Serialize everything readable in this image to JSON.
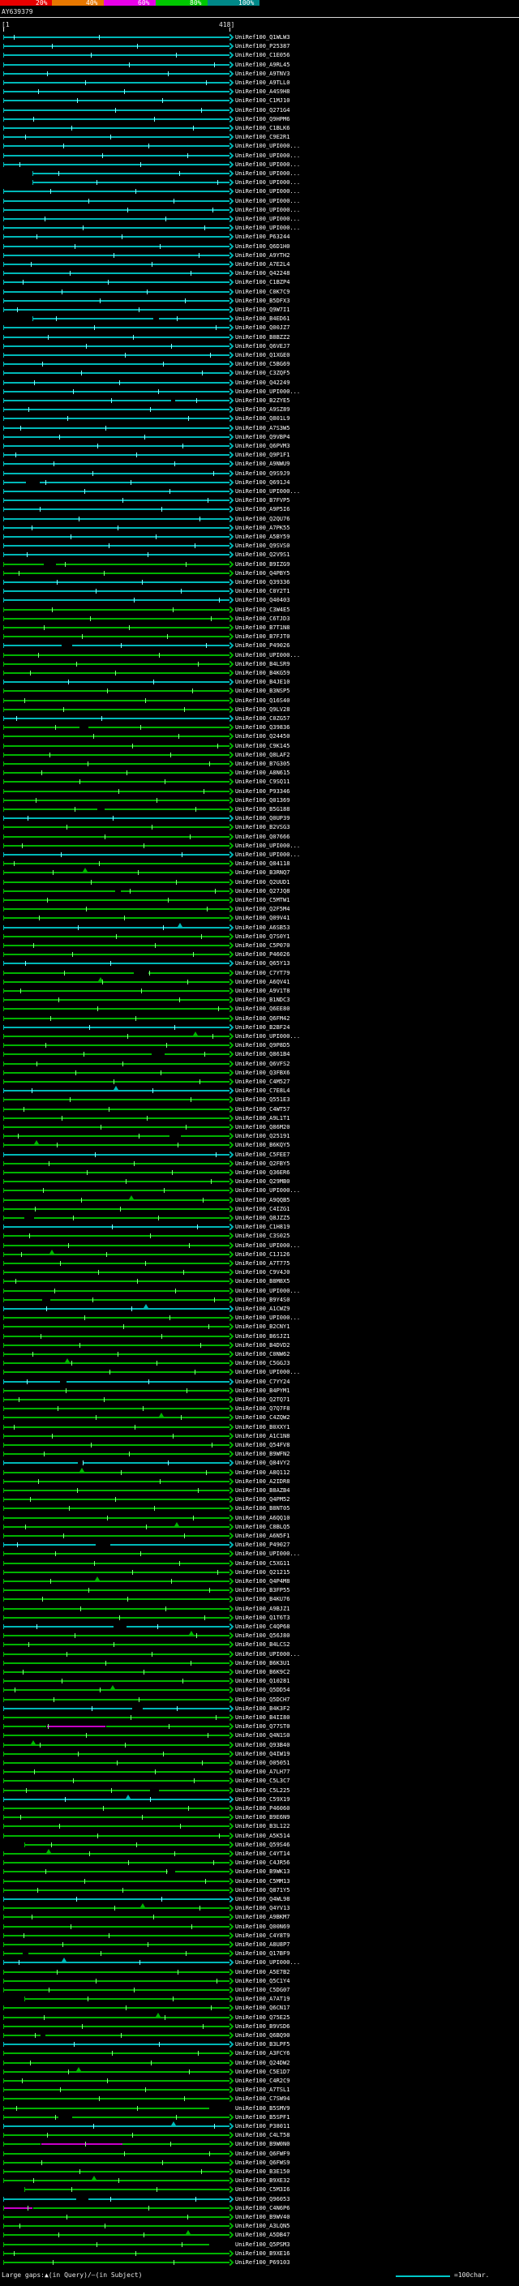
{
  "key": {
    "labels": [
      "20%",
      "40%",
      "60%",
      "80%",
      "100%"
    ],
    "colors": [
      "#e80000",
      "#e87800",
      "#e800e8",
      "#00c800",
      "#008888"
    ]
  },
  "ruler": {
    "left": "[1",
    "right": "418]"
  },
  "footer": {
    "legend_gaps": "Large gaps:▲(in Query)/—(in Subject)",
    "legend_scale": "=100char.",
    "scale_swatch_color": "#00c8c8"
  },
  "chart_data": {
    "type": "bar",
    "orientation": "horizontal",
    "title": "BLAST hit distribution vs UniRef100",
    "query": "AY639379",
    "x_range": [
      1,
      418
    ],
    "legend_position": "top",
    "grid": false,
    "id_prefix": "UniRef100_",
    "colors": {
      "c": "#00b8b8",
      "g": "#00b400",
      "m": "#c800c8"
    },
    "tick_colors": {
      "c": "#80ffff",
      "g": "#80ff80",
      "m": "#ff80ff"
    },
    "color_meaning": {
      "c": "80-100% identity",
      "g": "60-80% identity",
      "m": "40-60% identity"
    },
    "rows": [
      [
        "Q1WLW3",
        "c"
      ],
      [
        "P25387",
        "c"
      ],
      [
        "C1E056",
        "c"
      ],
      [
        "A9RL45",
        "c"
      ],
      [
        "A9TNV3",
        "c"
      ],
      [
        "A9TLL0",
        "c"
      ],
      [
        "A4S9H8",
        "c"
      ],
      [
        "C1MJ10",
        "c"
      ],
      [
        "Q271G4",
        "c"
      ],
      [
        "Q9HPM6",
        "c"
      ],
      [
        "C1BLK6",
        "c"
      ],
      [
        "C9E2R1",
        "c"
      ],
      [
        "UPI000...",
        "c"
      ],
      [
        "UPI000...",
        "c"
      ],
      [
        "UPI000...",
        "c"
      ],
      [
        "UPI000...",
        "c",
        {
          "s": 55
        }
      ],
      [
        "UPI000...",
        "c",
        {
          "s": 55
        }
      ],
      [
        "UPI000...",
        "c"
      ],
      [
        "UPI000...",
        "c"
      ],
      [
        "UPI000...",
        "c"
      ],
      [
        "UPI000...",
        "c"
      ],
      [
        "UPI000...",
        "c"
      ],
      [
        "P63244",
        "c"
      ],
      [
        "Q6D1H0",
        "c"
      ],
      [
        "A9YTH2",
        "c"
      ],
      [
        "A7E2L4",
        "c"
      ],
      [
        "Q42248",
        "c"
      ],
      [
        "C1BZP4",
        "c"
      ],
      [
        "C0K7C9",
        "c"
      ],
      [
        "B5DFX3",
        "c"
      ],
      [
        "Q9W7I1",
        "c"
      ],
      [
        "B4ED61",
        "c",
        {
          "s": 55
        }
      ],
      [
        "Q00JZ7",
        "c"
      ],
      [
        "B8BZZ2",
        "c"
      ],
      [
        "Q6VEJ7",
        "c"
      ],
      [
        "Q1XGE0",
        "c"
      ],
      [
        "C5BG69",
        "c"
      ],
      [
        "C3ZQF5",
        "c"
      ],
      [
        "Q42249",
        "c"
      ],
      [
        "UPI000...",
        "c"
      ],
      [
        "B2ZYE5",
        "c"
      ],
      [
        "A9SZ89",
        "c"
      ],
      [
        "Q801L9",
        "c"
      ],
      [
        "A7S3W5",
        "c"
      ],
      [
        "Q9VBP4",
        "c"
      ],
      [
        "Q6PVM3",
        "c"
      ],
      [
        "Q9P1F1",
        "c"
      ],
      [
        "A9NWU9",
        "c"
      ],
      [
        "Q9S9J9",
        "c"
      ],
      [
        "Q691J4",
        "c"
      ],
      [
        "UPI000...",
        "c"
      ],
      [
        "B7FVP5",
        "c"
      ],
      [
        "A9P5I6",
        "c"
      ],
      [
        "Q2QU76",
        "c"
      ],
      [
        "A7PK55",
        "c"
      ],
      [
        "A5BY59",
        "c"
      ],
      [
        "Q9SVS0",
        "c"
      ],
      [
        "Q2V9S1",
        "c"
      ],
      [
        "B9IZG9",
        "g"
      ],
      [
        "Q4PBY5",
        "g"
      ],
      [
        "Q39336",
        "c"
      ],
      [
        "C0Y2T1",
        "c"
      ],
      [
        "Q40403",
        "c"
      ],
      [
        "C3W4E5",
        "g"
      ],
      [
        "C6TJD3",
        "g"
      ],
      [
        "B7T1N8",
        "g"
      ],
      [
        "B7FJT0",
        "g"
      ],
      [
        "P49026",
        "c"
      ],
      [
        "UPI000...",
        "g"
      ],
      [
        "B4LSR9",
        "g"
      ],
      [
        "B4KG59",
        "g"
      ],
      [
        "B4JE10",
        "c"
      ],
      [
        "B3NSP5",
        "g"
      ],
      [
        "Q16S40",
        "g"
      ],
      [
        "Q9LV28",
        "g"
      ],
      [
        "C0ZG57",
        "c"
      ],
      [
        "Q39836",
        "g"
      ],
      [
        "Q24450",
        "g"
      ],
      [
        "C9K145",
        "g"
      ],
      [
        "Q8LAF2",
        "g"
      ],
      [
        "B7G305",
        "g"
      ],
      [
        "A8N615",
        "g"
      ],
      [
        "C9SQ11",
        "g"
      ],
      [
        "P93346",
        "g"
      ],
      [
        "Q01369",
        "g"
      ],
      [
        "B5G188",
        "g"
      ],
      [
        "Q0UP39",
        "c"
      ],
      [
        "B2VSG3",
        "g"
      ],
      [
        "Q07666",
        "g"
      ],
      [
        "UPI000...",
        "g"
      ],
      [
        "UPI000...",
        "c"
      ],
      [
        "Q84118",
        "g"
      ],
      [
        "B3RNQ7",
        "g"
      ],
      [
        "Q2UUD1",
        "g"
      ],
      [
        "Q27JQ8",
        "g"
      ],
      [
        "C5MTW1",
        "g"
      ],
      [
        "Q2F5M4",
        "g"
      ],
      [
        "Q09V41",
        "g"
      ],
      [
        "A6SB53",
        "c"
      ],
      [
        "Q7S0Y1",
        "g"
      ],
      [
        "C5P070",
        "g"
      ],
      [
        "P46026",
        "g"
      ],
      [
        "Q65Y13",
        "c"
      ],
      [
        "C7YT79",
        "g"
      ],
      [
        "A6QV41",
        "g"
      ],
      [
        "A9V1T8",
        "g"
      ],
      [
        "B1NDC3",
        "g"
      ],
      [
        "Q6EE80",
        "g"
      ],
      [
        "Q6FM42",
        "g"
      ],
      [
        "B2BF24",
        "c"
      ],
      [
        "UPI000...",
        "g"
      ],
      [
        "Q9P8D5",
        "g"
      ],
      [
        "Q861B4",
        "g"
      ],
      [
        "Q6VFS2",
        "g"
      ],
      [
        "Q3FBX6",
        "g"
      ],
      [
        "C4M527",
        "g"
      ],
      [
        "C7E8L4",
        "c"
      ],
      [
        "Q551E3",
        "g"
      ],
      [
        "C4WT57",
        "g"
      ],
      [
        "A9L1T1",
        "g"
      ],
      [
        "Q86M20",
        "g"
      ],
      [
        "Q25191",
        "g"
      ],
      [
        "B6KQY5",
        "g"
      ],
      [
        "C5FEE7",
        "c"
      ],
      [
        "Q2FBY5",
        "g"
      ],
      [
        "Q36ER6",
        "g"
      ],
      [
        "Q29MB0",
        "g"
      ],
      [
        "UPI000...",
        "g"
      ],
      [
        "A9QQB5",
        "g"
      ],
      [
        "C4IZG1",
        "g"
      ],
      [
        "Q8JZZ5",
        "g"
      ],
      [
        "C1H819",
        "c"
      ],
      [
        "C3S025",
        "g"
      ],
      [
        "UPI000...",
        "g"
      ],
      [
        "C1J126",
        "g"
      ],
      [
        "A7T775",
        "g"
      ],
      [
        "C9V4J0",
        "g"
      ],
      [
        "B8M8X5",
        "g"
      ],
      [
        "UPI000...",
        "g"
      ],
      [
        "B9Y4S0",
        "g"
      ],
      [
        "A1CWZ9",
        "c"
      ],
      [
        "UPI000...",
        "g"
      ],
      [
        "B2CNY1",
        "g"
      ],
      [
        "B6SJZ1",
        "g"
      ],
      [
        "B4DVD2",
        "g"
      ],
      [
        "C0NW62",
        "g"
      ],
      [
        "C5GGJ3",
        "g"
      ],
      [
        "UPI000...",
        "g"
      ],
      [
        "C7YY24",
        "c"
      ],
      [
        "B4PYM1",
        "g"
      ],
      [
        "Q2TQ71",
        "g"
      ],
      [
        "Q7Q7F8",
        "g"
      ],
      [
        "C4ZQW2",
        "g"
      ],
      [
        "B0XXY1",
        "g"
      ],
      [
        "A1C1N8",
        "g"
      ],
      [
        "Q54FV8",
        "g"
      ],
      [
        "B9WFN2",
        "g"
      ],
      [
        "Q84VY2",
        "c"
      ],
      [
        "A8Q112",
        "g"
      ],
      [
        "A2IDR8",
        "g"
      ],
      [
        "B8AZB4",
        "g"
      ],
      [
        "Q4PM52",
        "g"
      ],
      [
        "B8NT05",
        "g"
      ],
      [
        "A6QQ10",
        "g"
      ],
      [
        "C8BLQ5",
        "g"
      ],
      [
        "A6N5F1",
        "g"
      ],
      [
        "P49027",
        "c"
      ],
      [
        "UPI000...",
        "g"
      ],
      [
        "C5XG11",
        "g"
      ],
      [
        "Q21215",
        "g"
      ],
      [
        "Q4P4M8",
        "g"
      ],
      [
        "B3FP55",
        "g"
      ],
      [
        "B4KU76",
        "g"
      ],
      [
        "A9BJZ1",
        "g"
      ],
      [
        "Q1T6T3",
        "g"
      ],
      [
        "C4QP68",
        "c"
      ],
      [
        "Q56J80",
        "g"
      ],
      [
        "B4LCS2",
        "g"
      ],
      [
        "UPI000...",
        "g"
      ],
      [
        "B6K3U1",
        "g"
      ],
      [
        "B6K9C2",
        "g"
      ],
      [
        "Q10281",
        "g"
      ],
      [
        "Q5DD54",
        "g"
      ],
      [
        "Q5DCH7",
        "g"
      ],
      [
        "B4K3F2",
        "c"
      ],
      [
        "B4II80",
        "g"
      ],
      [
        "Q77ST0",
        "g",
        {
          "segs": [
            [
              1,
              80,
              "g"
            ],
            [
              81,
              190,
              "m"
            ],
            [
              191,
              418,
              "g"
            ]
          ]
        }
      ],
      [
        "Q4N1S0",
        "g"
      ],
      [
        "Q93B40",
        "g"
      ],
      [
        "Q4IW19",
        "g"
      ],
      [
        "O05051",
        "g"
      ],
      [
        "A7LH77",
        "g"
      ],
      [
        "C5L3C7",
        "g"
      ],
      [
        "C5L225",
        "g"
      ],
      [
        "C59X19",
        "c"
      ],
      [
        "P46060",
        "g"
      ],
      [
        "B9E6N9",
        "g"
      ],
      [
        "B3L122",
        "g"
      ],
      [
        "A5K514",
        "g"
      ],
      [
        "Q59S46",
        "g",
        {
          "s": 40
        }
      ],
      [
        "C4YT14",
        "g"
      ],
      [
        "C4JR56",
        "g"
      ],
      [
        "B9WK13",
        "g"
      ],
      [
        "C5MM13",
        "g"
      ],
      [
        "Q871Y5",
        "g"
      ],
      [
        "Q4WL98",
        "c"
      ],
      [
        "Q4YV13",
        "g"
      ],
      [
        "A9BKM7",
        "g"
      ],
      [
        "Q00N69",
        "g"
      ],
      [
        "C4Y8T9",
        "g"
      ],
      [
        "A8U8P7",
        "g"
      ],
      [
        "Q17BF9",
        "g"
      ],
      [
        "UPI000...",
        "c"
      ],
      [
        "A5E7B2",
        "g"
      ],
      [
        "Q5C1Y4",
        "g"
      ],
      [
        "C5DG07",
        "g"
      ],
      [
        "A7AT19",
        "g",
        {
          "s": 40
        }
      ],
      [
        "Q6CN17",
        "g"
      ],
      [
        "Q75E25",
        "g"
      ],
      [
        "B9VSD6",
        "g"
      ],
      [
        "Q6BQ90",
        "g"
      ],
      [
        "B3LPF5",
        "c"
      ],
      [
        "A3FCY6",
        "g"
      ],
      [
        "Q24DW2",
        "g"
      ],
      [
        "C5E1D7",
        "g"
      ],
      [
        "C4R2C9",
        "g"
      ],
      [
        "A7TSL1",
        "g"
      ],
      [
        "C7SW94",
        "g"
      ],
      [
        "B5SMV9",
        "g",
        {
          "e": 380
        }
      ],
      [
        "B5SPF1",
        "g"
      ],
      [
        "P38011",
        "c"
      ],
      [
        "C4LT58",
        "g"
      ],
      [
        "B9W0N0",
        "g",
        {
          "segs": [
            [
              1,
              70,
              "g"
            ],
            [
              71,
              220,
              "m"
            ],
            [
              221,
              418,
              "g"
            ]
          ]
        }
      ],
      [
        "Q6FWF9",
        "g"
      ],
      [
        "Q6FWS9",
        "g"
      ],
      [
        "B3E150",
        "g"
      ],
      [
        "B9XE32",
        "g"
      ],
      [
        "C5M3I6",
        "g",
        {
          "s": 40
        }
      ],
      [
        "Q96053",
        "c"
      ],
      [
        "C4N6P6",
        "g",
        {
          "segs": [
            [
              1,
              55,
              "m"
            ],
            [
              56,
              418,
              "g"
            ]
          ]
        }
      ],
      [
        "B9WV40",
        "g"
      ],
      [
        "A3LQN5",
        "g"
      ],
      [
        "A5DB47",
        "g"
      ],
      [
        "Q5PSM3",
        "g",
        {
          "e": 380
        }
      ],
      [
        "B9XE16",
        "g"
      ],
      [
        "P69103",
        "g"
      ]
    ]
  }
}
